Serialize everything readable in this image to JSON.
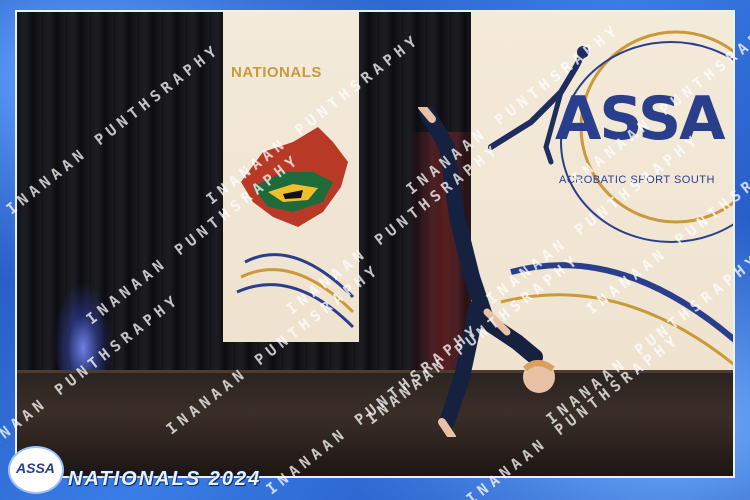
{
  "banner_left": {
    "title": "NATIONALS"
  },
  "banner_right": {
    "logo_text": "ASSA",
    "subtitle": "ACROBATIC SPORT SOUTH"
  },
  "watermark": {
    "text": "INANAAN PUNTHSRAPHY"
  },
  "footer": {
    "badge_text": "ASSA",
    "title": "NATIONALS 2024"
  },
  "colors": {
    "frame_blue": "#1d4fb8",
    "banner_cream": "#f3eadb",
    "logo_navy": "#2a3f8c",
    "nationals_gold": "#c99a3a"
  }
}
